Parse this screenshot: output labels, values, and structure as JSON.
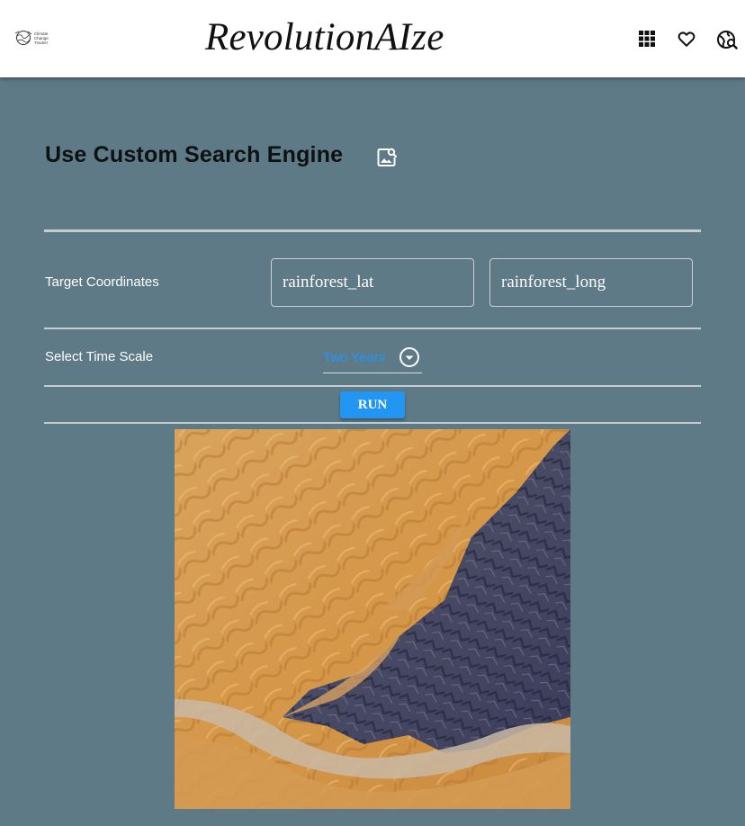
{
  "header": {
    "logo_text": "Climate Change Tracker",
    "title": "RevolutionAIze",
    "icons": [
      "apps-grid-icon",
      "heart-outline-icon",
      "globe-search-icon"
    ]
  },
  "main": {
    "section_title": "Use Custom Search Engine",
    "section_icon": "image-search-icon",
    "coordinates": {
      "label": "Target Coordinates",
      "lat_value": "rainforest_lat",
      "long_value": "rainforest_long"
    },
    "time_scale": {
      "label": "Select Time Scale",
      "selected": "Two Years"
    },
    "run_label": "RUN",
    "result_image": "satellite-desert-image"
  },
  "colors": {
    "background": "#5f7a87",
    "accent": "#2196f3",
    "header_bg": "#ffffff"
  }
}
